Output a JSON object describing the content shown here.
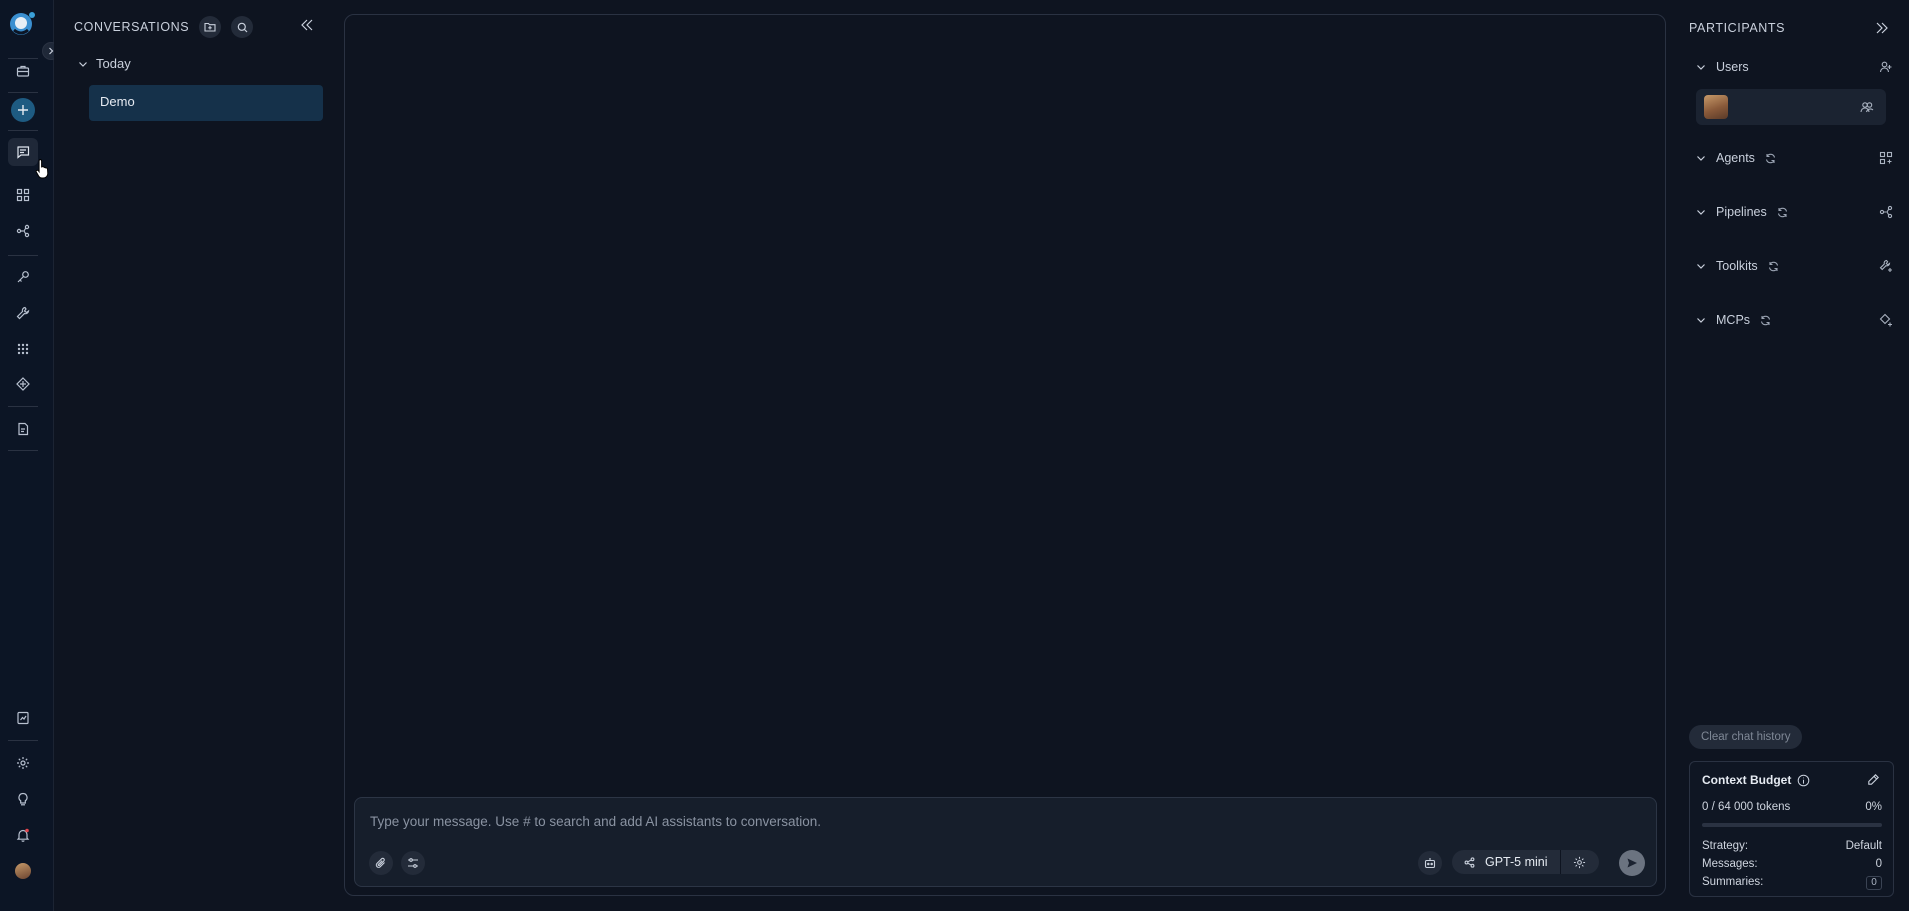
{
  "sidebar": {
    "icons": [
      "logo-icon",
      "briefcase-icon",
      "add-icon",
      "chat-icon",
      "apps-grid-icon",
      "pipeline-icon",
      "key-icon",
      "wrench-icon",
      "grid-dots-icon",
      "diamond-icon",
      "document-icon",
      "report-icon",
      "settings-icon",
      "bulb-icon",
      "bell-icon",
      "avatar"
    ]
  },
  "conversations": {
    "title": "CONVERSATIONS",
    "groups": [
      {
        "label": "Today",
        "items": [
          {
            "label": "Demo"
          }
        ]
      }
    ]
  },
  "composer": {
    "placeholder": "Type your message. Use # to search and add AI assistants to conversation.",
    "model": "GPT-5 mini"
  },
  "participants": {
    "title": "PARTICIPANTS",
    "sections": [
      {
        "label": "Users"
      },
      {
        "label": "Agents"
      },
      {
        "label": "Pipelines"
      },
      {
        "label": "Toolkits"
      },
      {
        "label": "MCPs"
      }
    ],
    "clear_label": "Clear chat history",
    "context_budget": {
      "title": "Context Budget",
      "tokens_text": "0 / 64 000 tokens",
      "percent_text": "0%",
      "progress_fraction": 0,
      "strategy_label": "Strategy:",
      "strategy_value": "Default",
      "messages_label": "Messages:",
      "messages_value": "0",
      "summaries_label": "Summaries:",
      "summaries_value": "0"
    }
  },
  "colors": {
    "background": "#0e1420",
    "rail": "#0c1525",
    "selected_item": "#15314a",
    "accent": "#3aa0d8"
  }
}
